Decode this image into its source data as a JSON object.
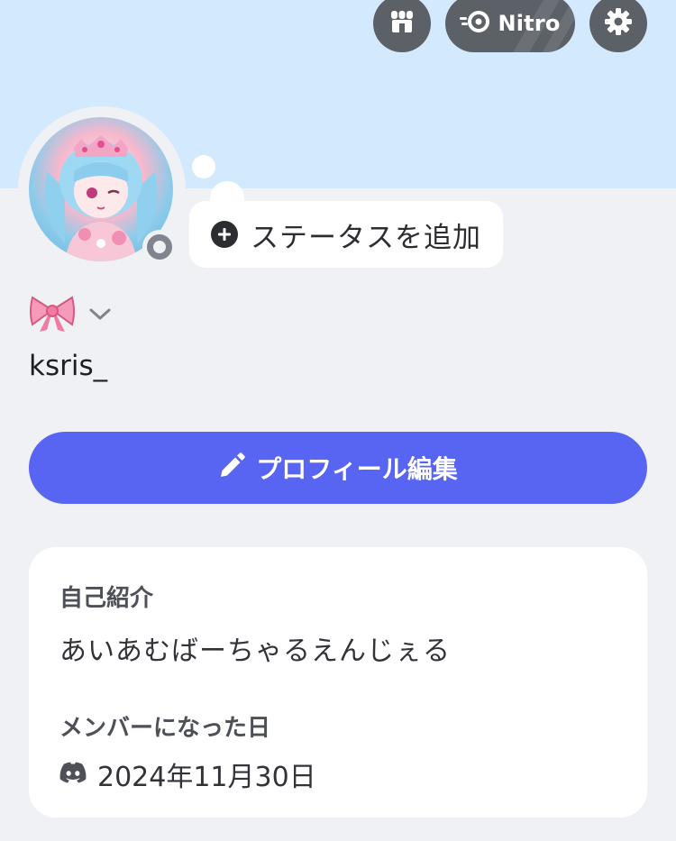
{
  "header": {
    "shop_icon": "shop-icon",
    "nitro_icon": "nitro-icon",
    "nitro_label": "Nitro",
    "settings_icon": "gear-icon"
  },
  "status": {
    "add_label": "ステータスを追加",
    "online_state": "offline"
  },
  "profile": {
    "display_name_emoji": "🎀",
    "username": "ksris_",
    "edit_label": "プロフィール編集"
  },
  "about": {
    "bio_heading": "自己紹介",
    "bio_text": "あいあむばーちゃるえんじぇる",
    "member_since_heading": "メンバーになった日",
    "member_since_date": "2024年11月30日"
  },
  "colors": {
    "banner": "#d3e9fd",
    "accent": "#5865f2",
    "background": "#f0f1f5"
  }
}
